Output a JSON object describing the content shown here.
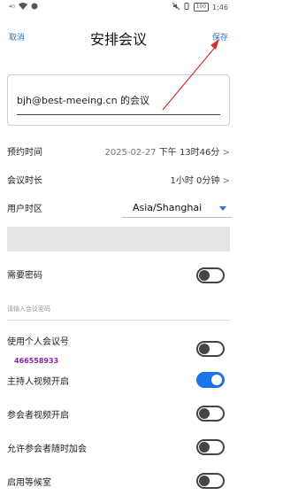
{
  "status": {
    "signal": "⁴ᴳ",
    "time": "1:46",
    "battery": "100"
  },
  "header": {
    "cancel": "取消",
    "title": "安排会议",
    "save": "保存"
  },
  "topic": {
    "value": "bjh@best-meeing.cn 的会议"
  },
  "schedule": {
    "start_label": "预约时间",
    "start_date": "2025-02-27",
    "start_time": "下午 13时46分",
    "duration_label": "会议时长",
    "duration_value": "1小时 0分钟",
    "timezone_label": "用户时区",
    "timezone_value": "Asia/Shanghai"
  },
  "password": {
    "label": "需要密码",
    "enabled": false,
    "placeholder": "请输入会议密码"
  },
  "options": {
    "pmi_label": "使用个人会议号",
    "pmi_enabled": false,
    "pmi_number": "466558933",
    "host_video_label": "主持人视频开启",
    "host_video_enabled": true,
    "participant_video_label": "参会者视频开启",
    "participant_video_enabled": false,
    "join_anytime_label": "允许参会者随时加会",
    "join_anytime_enabled": false,
    "waiting_room_label": "启用等候室",
    "waiting_room_enabled": false
  },
  "colors": {
    "accent": "#1a73e8",
    "link": "#2f6fd6",
    "annotation_arrow": "#d32f2f",
    "meeting_number": "#8a1fa8"
  }
}
